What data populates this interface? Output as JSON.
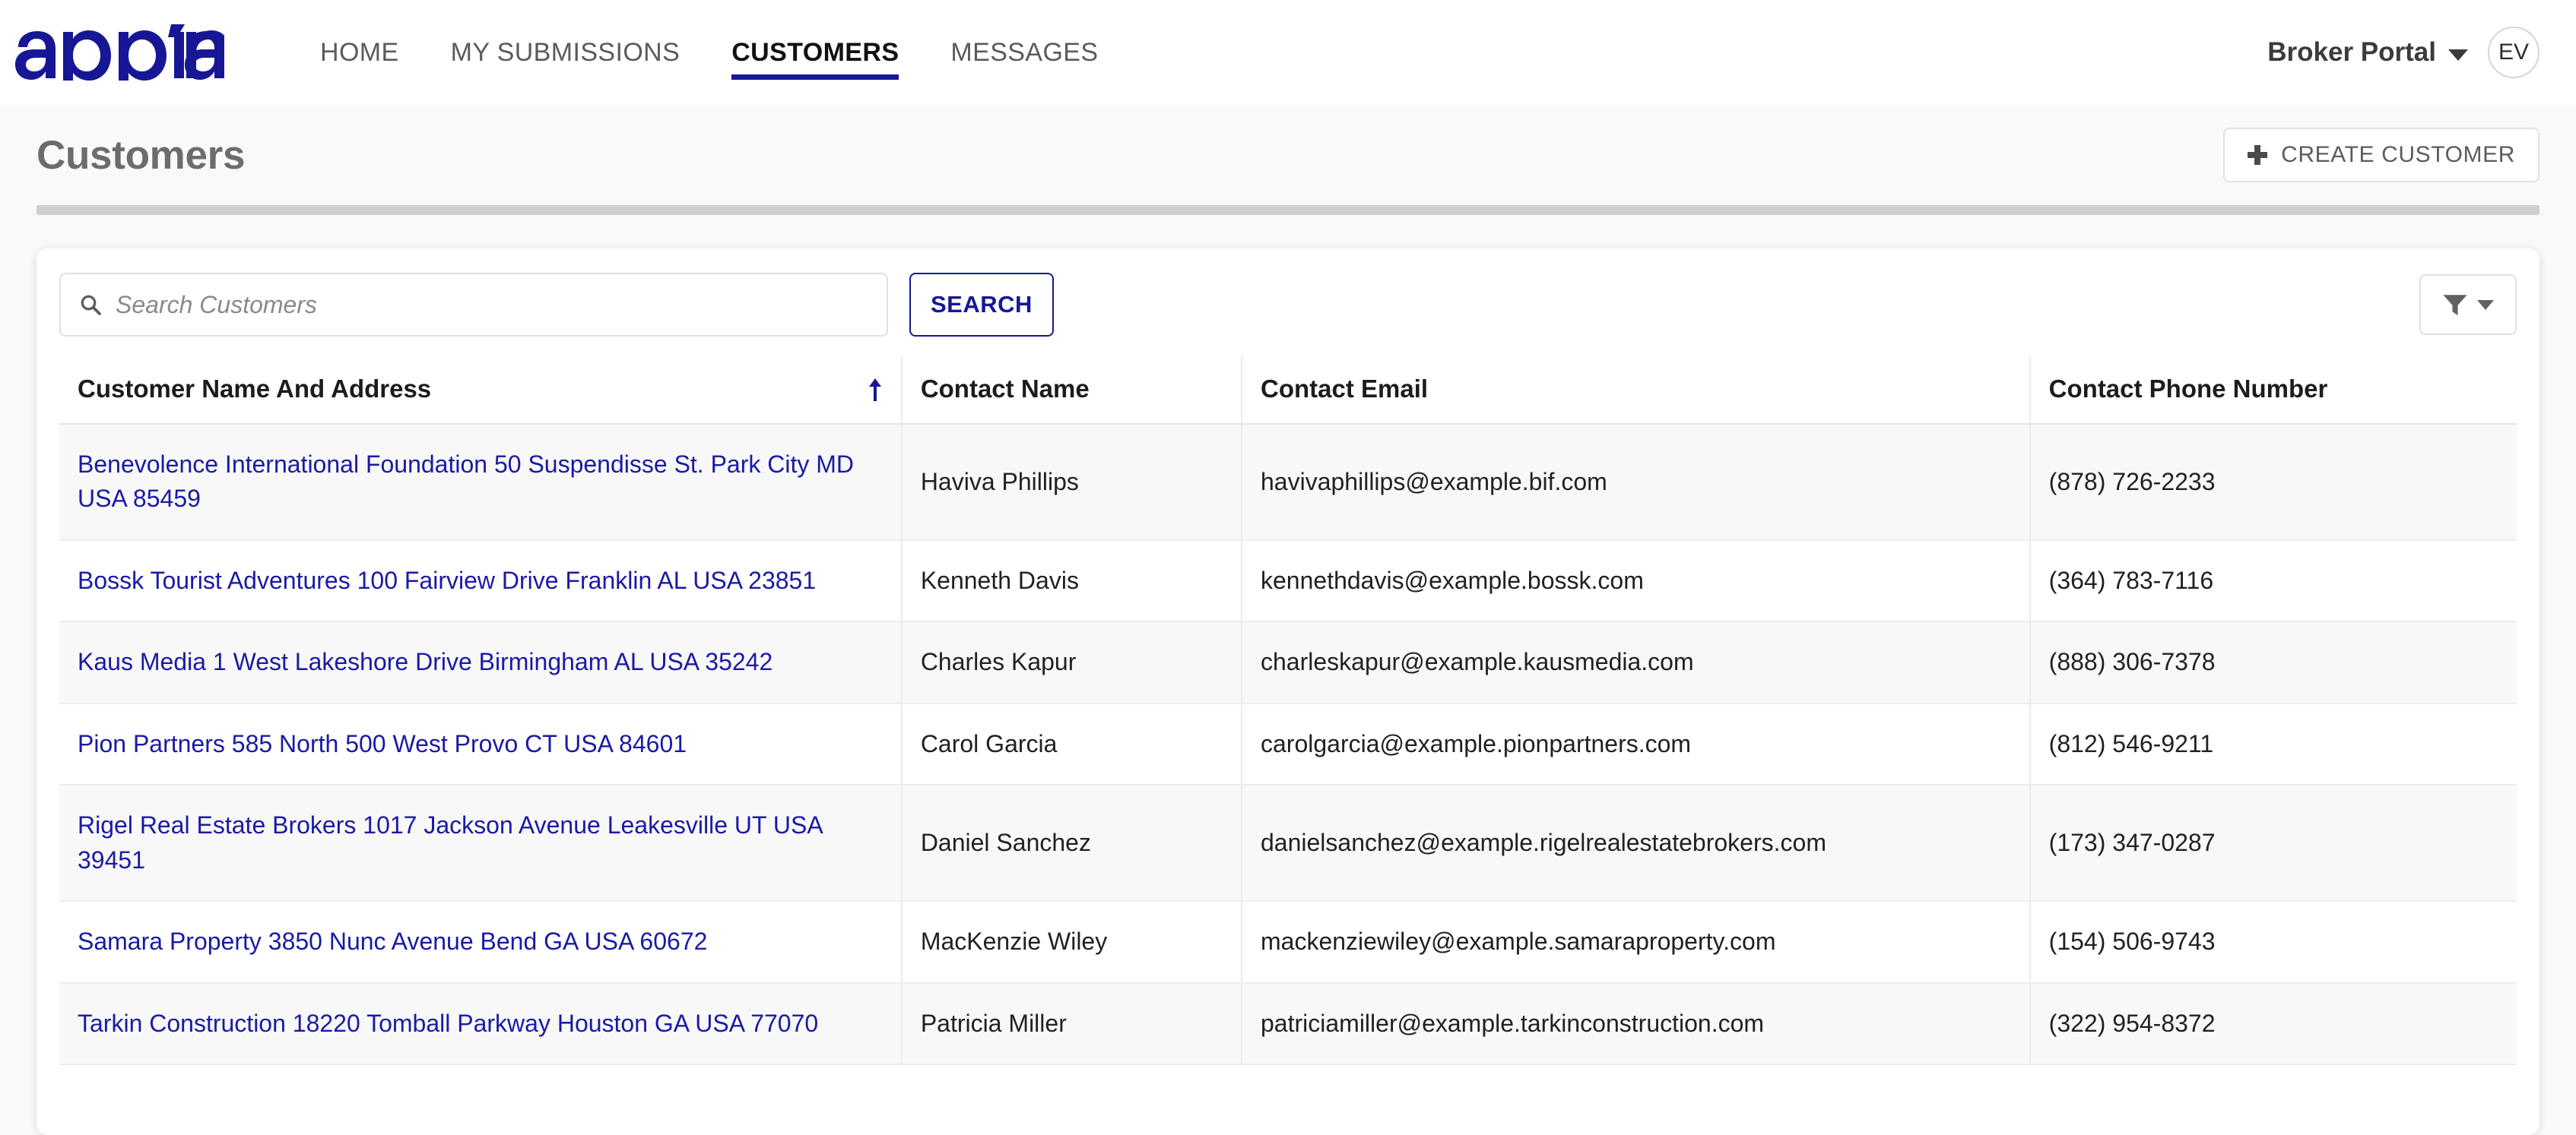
{
  "brand": {
    "logo_text": "appian",
    "logo_color": "#171796"
  },
  "nav": {
    "items": [
      {
        "label": "HOME",
        "active": false
      },
      {
        "label": "MY SUBMISSIONS",
        "active": false
      },
      {
        "label": "CUSTOMERS",
        "active": true
      },
      {
        "label": "MESSAGES",
        "active": false
      }
    ],
    "portal_label": "Broker Portal",
    "avatar_initials": "EV"
  },
  "page": {
    "title": "Customers",
    "create_button_label": "CREATE CUSTOMER"
  },
  "toolbar": {
    "search_placeholder": "Search Customers",
    "search_value": "",
    "search_button_label": "SEARCH",
    "filter_icon": "funnel-icon"
  },
  "table": {
    "columns": [
      {
        "label": "Customer Name And Address",
        "sorted": "asc"
      },
      {
        "label": "Contact Name",
        "sorted": null
      },
      {
        "label": "Contact Email",
        "sorted": null
      },
      {
        "label": "Contact Phone Number",
        "sorted": null
      }
    ],
    "rows": [
      {
        "name_address": "Benevolence International Foundation 50 Suspendisse St. Park City MD USA 85459",
        "contact_name": "Haviva Phillips",
        "contact_email": "havivaphillips@example.bif.com",
        "contact_phone": "(878) 726-2233"
      },
      {
        "name_address": "Bossk Tourist Adventures 100 Fairview Drive Franklin AL USA 23851",
        "contact_name": "Kenneth Davis",
        "contact_email": "kennethdavis@example.bossk.com",
        "contact_phone": "(364) 783-7116"
      },
      {
        "name_address": "Kaus Media 1 West Lakeshore Drive Birmingham AL USA 35242",
        "contact_name": "Charles Kapur",
        "contact_email": "charleskapur@example.kausmedia.com",
        "contact_phone": "(888) 306-7378"
      },
      {
        "name_address": "Pion Partners 585 North 500 West Provo CT USA 84601",
        "contact_name": "Carol Garcia",
        "contact_email": "carolgarcia@example.pionpartners.com",
        "contact_phone": "(812) 546-9211"
      },
      {
        "name_address": "Rigel Real Estate Brokers 1017 Jackson Avenue Leakesville UT USA 39451",
        "contact_name": "Daniel Sanchez",
        "contact_email": "danielsanchez@example.rigelrealestatebrokers.com",
        "contact_phone": "(173) 347-0287"
      },
      {
        "name_address": "Samara Property 3850 Nunc Avenue Bend GA USA 60672",
        "contact_name": "MacKenzie Wiley",
        "contact_email": "mackenziewiley@example.samaraproperty.com",
        "contact_phone": "(154) 506-9743"
      },
      {
        "name_address": "Tarkin Construction 18220 Tomball Parkway Houston GA USA 77070",
        "contact_name": "Patricia Miller",
        "contact_email": "patriciamiller@example.tarkinconstruction.com",
        "contact_phone": "(322) 954-8372"
      }
    ]
  },
  "colors": {
    "brand_navy": "#171796",
    "link_blue": "#1a1aa6",
    "page_bg": "#f8f9fa",
    "row_alt": "#f8f8f8"
  }
}
